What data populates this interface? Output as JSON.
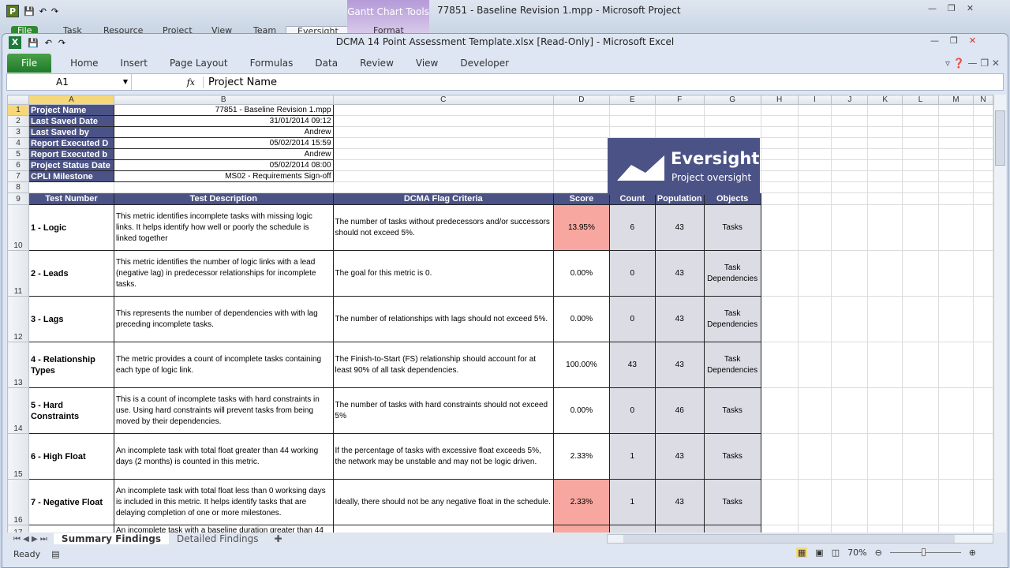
{
  "project_window": {
    "title": "77851 - Baseline Revision 1.mpp  -  Microsoft Project",
    "contextual_tab": "Gantt Chart Tools",
    "tabs": [
      "File",
      "Task",
      "Resource",
      "Project",
      "View",
      "Team",
      "Eversight",
      "Format"
    ]
  },
  "excel_window": {
    "title": "DCMA 14 Point Assessment Template.xlsx  [Read-Only]  -  Microsoft Excel",
    "ribbon_tabs": [
      "File",
      "Home",
      "Insert",
      "Page Layout",
      "Formulas",
      "Data",
      "Review",
      "View",
      "Developer"
    ],
    "name_box": "A1",
    "fx": "fx",
    "formula": "Project Name"
  },
  "columns": [
    "A",
    "B",
    "C",
    "D",
    "E",
    "F",
    "G",
    "H",
    "I",
    "J",
    "K",
    "L",
    "M",
    "N"
  ],
  "info": [
    {
      "row": "1",
      "label": "Project Name",
      "value": "77851 - Baseline Revision 1.mpp"
    },
    {
      "row": "2",
      "label": "Last Saved Date",
      "value": "31/01/2014 09:12"
    },
    {
      "row": "3",
      "label": "Last Saved by",
      "value": "Andrew"
    },
    {
      "row": "4",
      "label": "Report Executed D",
      "value": "05/02/2014 15:59"
    },
    {
      "row": "5",
      "label": "Report Executed b",
      "value": "Andrew"
    },
    {
      "row": "6",
      "label": "Project Status Date",
      "value": "05/02/2014 08:00"
    },
    {
      "row": "7",
      "label": "CPLI Milestone",
      "value": "MS02 - Requirements Sign-off"
    }
  ],
  "logo": {
    "name": "Eversight",
    "tagline": "Project oversight"
  },
  "headers": {
    "row": "9",
    "test": "Test Number",
    "desc": "Test Description",
    "criteria": "DCMA Flag Criteria",
    "score": "Score",
    "count": "Count",
    "population": "Population",
    "objects": "Objects"
  },
  "tests": [
    {
      "row": "10",
      "test": "1 - Logic",
      "desc": "This metric identifies incomplete tasks with missing logic links. It helps identify how well or poorly the schedule is linked together",
      "criteria": "The number of tasks without predecessors and/or successors should not exceed 5%.",
      "score": "13.95%",
      "count": "6",
      "population": "43",
      "objects": "Tasks",
      "flag": true
    },
    {
      "row": "11",
      "test": "2 - Leads",
      "desc": "This metric identifies the number of logic links with a lead (negative lag) in predecessor relationships for incomplete tasks.",
      "criteria": "The goal for this metric is 0.",
      "score": "0.00%",
      "count": "0",
      "population": "43",
      "objects": "Task Dependencies",
      "flag": false
    },
    {
      "row": "12",
      "test": "3 - Lags",
      "desc": "This represents the number of dependencies with with lag preceding incomplete tasks.",
      "criteria": "The number of relationships with lags should not exceed 5%.",
      "score": "0.00%",
      "count": "0",
      "population": "43",
      "objects": "Task Dependencies",
      "flag": false
    },
    {
      "row": "13",
      "test": "4 - Relationship Types",
      "desc": "The metric provides a count of incomplete tasks containing each type of logic link.",
      "criteria": "The Finish-to-Start (FS) relationship should account for at least 90% of all task dependencies.",
      "score": "100.00%",
      "count": "43",
      "population": "43",
      "objects": "Task Dependencies",
      "flag": false
    },
    {
      "row": "14",
      "test": "5 - Hard Constraints",
      "desc": "This is a count of incomplete tasks with hard constraints in use. Using hard constraints will prevent tasks from being moved by their dependencies.",
      "criteria": "The number of tasks with hard constraints should not exceed 5%",
      "score": "0.00%",
      "count": "0",
      "population": "46",
      "objects": "Tasks",
      "flag": false
    },
    {
      "row": "15",
      "test": "6 - High Float",
      "desc": "An incomplete task with total float greater than 44 working days (2 months) is counted in this metric.",
      "criteria": "If the percentage of tasks with excessive float exceeds 5%, the network may be unstable and may not be logic driven.",
      "score": "2.33%",
      "count": "1",
      "population": "43",
      "objects": "Tasks",
      "flag": false
    },
    {
      "row": "16",
      "test": "7 - Negative Float",
      "desc": "An incomplete task with total float less than 0 worksing days is included in this metric. It helps identify tasks that are delaying completion of one or more milestones.",
      "criteria": "Ideally, there should not be any negative float in the schedule.",
      "score": "2.33%",
      "count": "1",
      "population": "43",
      "objects": "Tasks",
      "flag": true
    }
  ],
  "partial_row": {
    "row": "17",
    "desc": "An incomplete task with a baseline duration greater than 44"
  },
  "sheet_tabs": [
    "Summary Findings",
    "Detailed Findings"
  ],
  "status": {
    "ready": "Ready",
    "zoom": "70%"
  },
  "colors": {
    "header": "#4b5386",
    "flag": "#f7a79f",
    "gray": "#dcdce4"
  }
}
